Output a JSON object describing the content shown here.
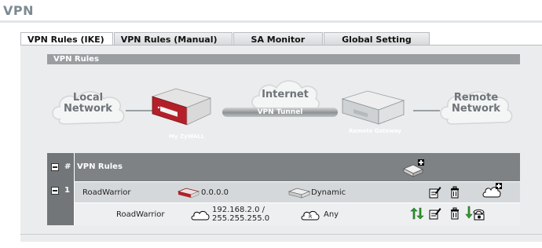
{
  "page": {
    "title": "VPN"
  },
  "tabs": [
    {
      "label": "VPN Rules (IKE)",
      "active": true
    },
    {
      "label": "VPN Rules (Manual)",
      "active": false
    },
    {
      "label": "SA Monitor",
      "active": false
    },
    {
      "label": "Global Setting",
      "active": false
    }
  ],
  "section": {
    "title": "VPN Rules"
  },
  "diagram": {
    "local_network": "Local\nNetwork",
    "internet": "Internet",
    "remote_network": "Remote\nNetwork",
    "tunnel_label": "VPN Tunnel",
    "local_device": "My ZyWALL",
    "remote_device": "Remote Gateway"
  },
  "table": {
    "header": {
      "number": "#",
      "rules": "VPN Rules"
    },
    "gateway_rule": {
      "number": "1",
      "name": "RoadWarrior",
      "local_gateway": "0.0.0.0",
      "remote_gateway": "Dynamic"
    },
    "network_policy": {
      "name": "RoadWarrior",
      "local_network": "192.168.2.0 /",
      "local_mask": "255.255.255.0",
      "remote_network": "Any"
    }
  },
  "colors": {
    "accent_red": "#b3202a",
    "header_gray": "#7e8285",
    "panel": "#ebeced"
  },
  "icons": [
    "add-gateway-icon",
    "edit-icon",
    "delete-icon",
    "add-policy-icon",
    "move-icon",
    "dial-icon",
    "router-icon",
    "cloud-icon"
  ]
}
